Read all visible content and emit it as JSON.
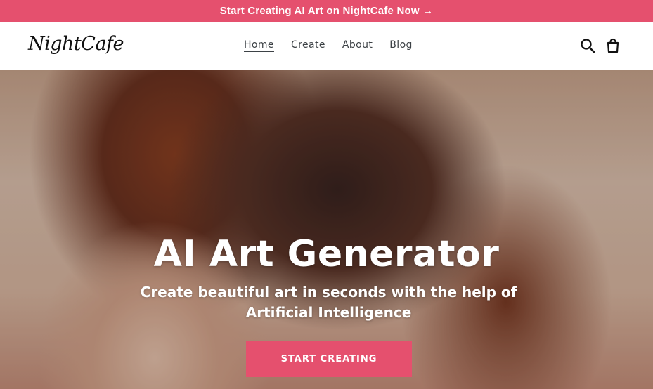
{
  "announcement": {
    "text": "Start Creating AI Art on NightCafe Now →"
  },
  "header": {
    "logo": "NightCafe",
    "nav": [
      {
        "label": "Home",
        "active": true
      },
      {
        "label": "Create"
      },
      {
        "label": "About"
      },
      {
        "label": "Blog"
      }
    ],
    "icons": {
      "search": "search-icon",
      "cart": "cart-icon"
    }
  },
  "hero": {
    "title": "AI Art Generator",
    "subtitle": "Create beautiful art in seconds with the help of Artificial Intelligence",
    "cta_label": "START CREATING"
  },
  "colors": {
    "accent": "#e5506e",
    "nav_text": "#3d4246"
  }
}
